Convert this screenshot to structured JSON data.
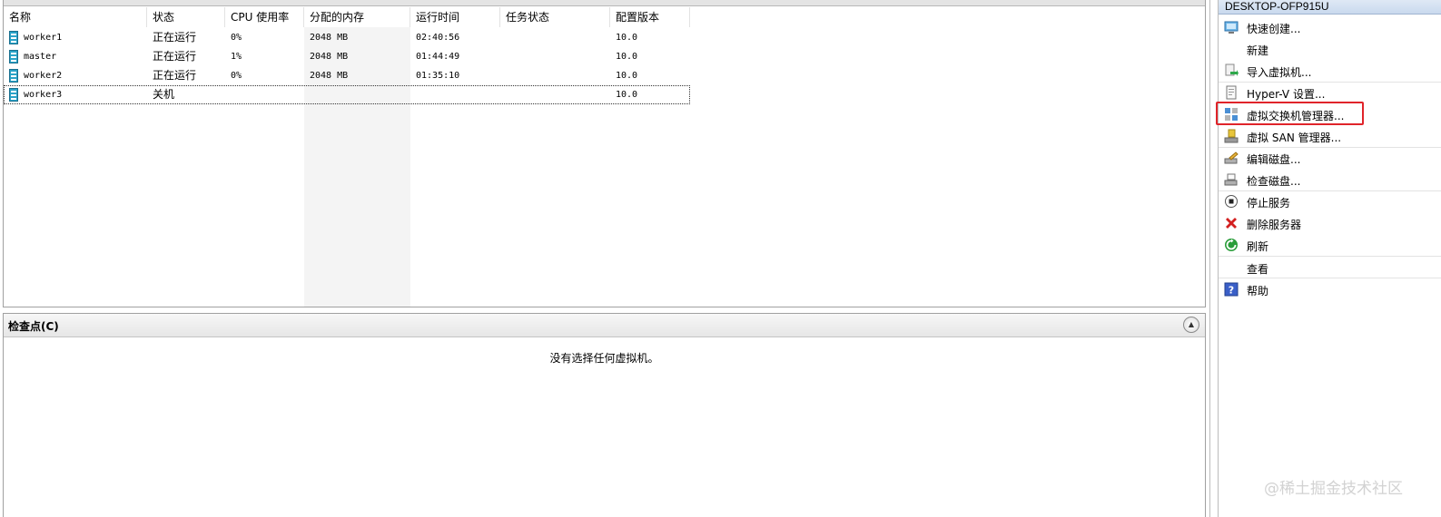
{
  "vm_list": {
    "columns": [
      "名称",
      "状态",
      "CPU 使用率",
      "分配的内存",
      "运行时间",
      "任务状态",
      "配置版本"
    ],
    "sorted_column": "分配的内存",
    "rows": [
      {
        "name": "worker1",
        "state": "正在运行",
        "cpu": "0%",
        "memory": "2048 MB",
        "uptime": "02:40:56",
        "task": "",
        "version": "10.0"
      },
      {
        "name": "master",
        "state": "正在运行",
        "cpu": "1%",
        "memory": "2048 MB",
        "uptime": "01:44:49",
        "task": "",
        "version": "10.0"
      },
      {
        "name": "worker2",
        "state": "正在运行",
        "cpu": "0%",
        "memory": "2048 MB",
        "uptime": "01:35:10",
        "task": "",
        "version": "10.0"
      },
      {
        "name": "worker3",
        "state": "关机",
        "cpu": "",
        "memory": "",
        "uptime": "",
        "task": "",
        "version": "10.0"
      }
    ],
    "selected_row": "worker3"
  },
  "checkpoints": {
    "title": "检查点(C)",
    "empty_message": "没有选择任何虚拟机。",
    "collapse_glyph": "▲"
  },
  "actions": {
    "host": "DESKTOP-OFP915U",
    "items": [
      {
        "label": "快速创建...",
        "icon": "quick-create-icon"
      },
      {
        "label": "新建",
        "icon": "none"
      },
      {
        "label": "导入虚拟机...",
        "icon": "import-vm-icon"
      },
      {
        "label": "Hyper-V 设置...",
        "icon": "settings-icon"
      },
      {
        "label": "虚拟交换机管理器...",
        "icon": "switch-manager-icon"
      },
      {
        "label": "虚拟 SAN 管理器...",
        "icon": "san-manager-icon"
      },
      {
        "label": "编辑磁盘...",
        "icon": "edit-disk-icon"
      },
      {
        "label": "检查磁盘...",
        "icon": "inspect-disk-icon"
      },
      {
        "label": "停止服务",
        "icon": "stop-icon"
      },
      {
        "label": "删除服务器",
        "icon": "delete-icon"
      },
      {
        "label": "刷新",
        "icon": "refresh-icon"
      },
      {
        "label": "查看",
        "icon": "none"
      },
      {
        "label": "帮助",
        "icon": "help-icon"
      }
    ],
    "highlighted_item": "虚拟交换机管理器..."
  },
  "watermark": "@稀土掘金技术社区",
  "colors": {
    "highlight_border": "#e0242a",
    "vm_icon": "#2aa3c8",
    "delete_icon": "#d32020",
    "refresh_icon": "#2a9d3a",
    "help_icon": "#3a5fc8"
  }
}
